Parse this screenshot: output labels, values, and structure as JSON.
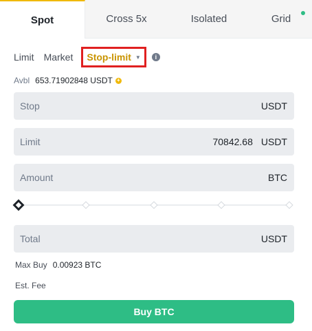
{
  "tabs": [
    {
      "label": "Spot"
    },
    {
      "label": "Cross 5x"
    },
    {
      "label": "Isolated"
    },
    {
      "label": "Grid"
    }
  ],
  "order_types": {
    "limit": "Limit",
    "market": "Market",
    "stop_limit": "Stop-limit"
  },
  "avbl": {
    "label": "Avbl",
    "value": "653.71902848 USDT"
  },
  "fields": {
    "stop": {
      "label": "Stop",
      "value": "",
      "unit": "USDT"
    },
    "limit": {
      "label": "Limit",
      "value": "70842.68",
      "unit": "USDT"
    },
    "amount": {
      "label": "Amount",
      "value": "",
      "unit": "BTC"
    },
    "total": {
      "label": "Total",
      "value": "",
      "unit": "USDT"
    }
  },
  "slider": {
    "value_percent": 0
  },
  "max_buy": {
    "label": "Max Buy",
    "value": "0.00923 BTC"
  },
  "est_fee": {
    "label": "Est. Fee"
  },
  "buy_button": {
    "label": "Buy BTC"
  },
  "colors": {
    "accent": "#f0b90b",
    "active_order_type": "#c99400",
    "buy": "#2ebd85",
    "highlight_box": "#e02020"
  },
  "icons": {
    "info": "info-icon",
    "add": "plus-circle-icon",
    "dropdown": "caret-down-icon"
  }
}
